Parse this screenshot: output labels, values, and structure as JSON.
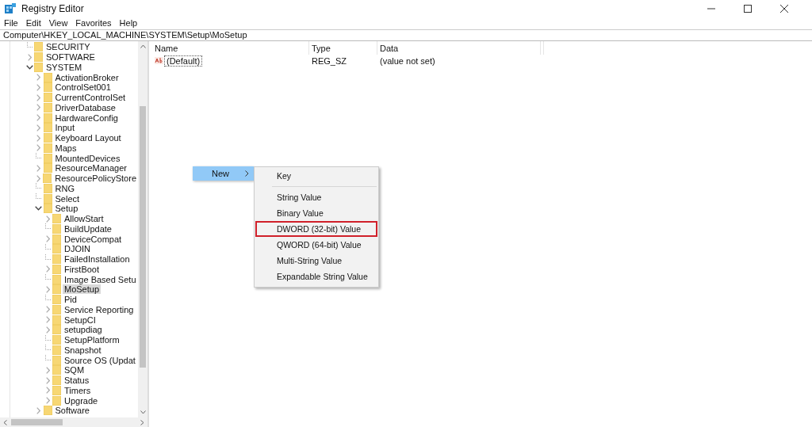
{
  "window": {
    "title": "Registry Editor"
  },
  "menu": [
    "File",
    "Edit",
    "View",
    "Favorites",
    "Help"
  ],
  "address": "Computer\\HKEY_LOCAL_MACHINE\\SYSTEM\\Setup\\MoSetup",
  "tree": [
    {
      "label": "SECURITY",
      "kind": "leaf",
      "selected": false
    },
    {
      "label": "SOFTWARE",
      "kind": "branch",
      "expanded": false,
      "selected": false
    },
    {
      "label": "SYSTEM",
      "kind": "branch",
      "expanded": true,
      "selected": false,
      "children": [
        {
          "label": "ActivationBroker",
          "kind": "branch",
          "expanded": false,
          "selected": false
        },
        {
          "label": "ControlSet001",
          "kind": "branch",
          "expanded": false,
          "selected": false
        },
        {
          "label": "CurrentControlSet",
          "kind": "branch",
          "expanded": false,
          "selected": false
        },
        {
          "label": "DriverDatabase",
          "kind": "branch",
          "expanded": false,
          "selected": false
        },
        {
          "label": "HardwareConfig",
          "kind": "branch",
          "expanded": false,
          "selected": false
        },
        {
          "label": "Input",
          "kind": "branch",
          "expanded": false,
          "selected": false
        },
        {
          "label": "Keyboard Layout",
          "kind": "branch",
          "expanded": false,
          "selected": false
        },
        {
          "label": "Maps",
          "kind": "branch",
          "expanded": false,
          "selected": false
        },
        {
          "label": "MountedDevices",
          "kind": "leaf",
          "selected": false
        },
        {
          "label": "ResourceManager",
          "kind": "branch",
          "expanded": false,
          "selected": false
        },
        {
          "label": "ResourcePolicyStore",
          "kind": "branch",
          "expanded": false,
          "selected": false
        },
        {
          "label": "RNG",
          "kind": "leaf",
          "selected": false
        },
        {
          "label": "Select",
          "kind": "leaf",
          "selected": false
        },
        {
          "label": "Setup",
          "kind": "branch",
          "expanded": true,
          "selected": false,
          "children": [
            {
              "label": "AllowStart",
              "kind": "branch",
              "expanded": false,
              "selected": false
            },
            {
              "label": "BuildUpdate",
              "kind": "leaf",
              "selected": false
            },
            {
              "label": "DeviceCompat",
              "kind": "branch",
              "expanded": false,
              "selected": false
            },
            {
              "label": "DJOIN",
              "kind": "leaf",
              "selected": false
            },
            {
              "label": "FailedInstallation",
              "kind": "leaf",
              "selected": false
            },
            {
              "label": "FirstBoot",
              "kind": "branch",
              "expanded": false,
              "selected": false
            },
            {
              "label": "Image Based Setu",
              "kind": "leaf",
              "selected": false
            },
            {
              "label": "MoSetup",
              "kind": "branch",
              "expanded": false,
              "selected": true
            },
            {
              "label": "Pid",
              "kind": "leaf",
              "selected": false
            },
            {
              "label": "Service Reporting",
              "kind": "branch",
              "expanded": false,
              "selected": false
            },
            {
              "label": "SetupCI",
              "kind": "branch",
              "expanded": false,
              "selected": false
            },
            {
              "label": "setupdiag",
              "kind": "branch",
              "expanded": false,
              "selected": false
            },
            {
              "label": "SetupPlatform",
              "kind": "leaf",
              "selected": false
            },
            {
              "label": "Snapshot",
              "kind": "leaf",
              "selected": false
            },
            {
              "label": "Source OS (Updat",
              "kind": "leaf",
              "selected": false
            },
            {
              "label": "SQM",
              "kind": "branch",
              "expanded": false,
              "selected": false
            },
            {
              "label": "Status",
              "kind": "branch",
              "expanded": false,
              "selected": false
            },
            {
              "label": "Timers",
              "kind": "branch",
              "expanded": false,
              "selected": false
            },
            {
              "label": "Upgrade",
              "kind": "branch",
              "expanded": false,
              "selected": false
            }
          ]
        },
        {
          "label": "Software",
          "kind": "branch",
          "expanded": false,
          "selected": false
        }
      ]
    }
  ],
  "values": {
    "columns": [
      "Name",
      "Type",
      "Data"
    ],
    "rows": [
      {
        "name": "(Default)",
        "type": "REG_SZ",
        "data": "(value not set)",
        "focused": true
      }
    ]
  },
  "context_menu": {
    "item": {
      "label": "New",
      "selected": true
    },
    "submenu": [
      {
        "kind": "item",
        "label": "Key",
        "highlighted": false
      },
      {
        "kind": "separator"
      },
      {
        "kind": "item",
        "label": "String Value",
        "highlighted": false
      },
      {
        "kind": "item",
        "label": "Binary Value",
        "highlighted": false
      },
      {
        "kind": "item",
        "label": "DWORD (32-bit) Value",
        "highlighted": true
      },
      {
        "kind": "item",
        "label": "QWORD (64-bit) Value",
        "highlighted": false
      },
      {
        "kind": "item",
        "label": "Multi-String Value",
        "highlighted": false
      },
      {
        "kind": "item",
        "label": "Expandable String Value",
        "highlighted": false
      }
    ]
  }
}
